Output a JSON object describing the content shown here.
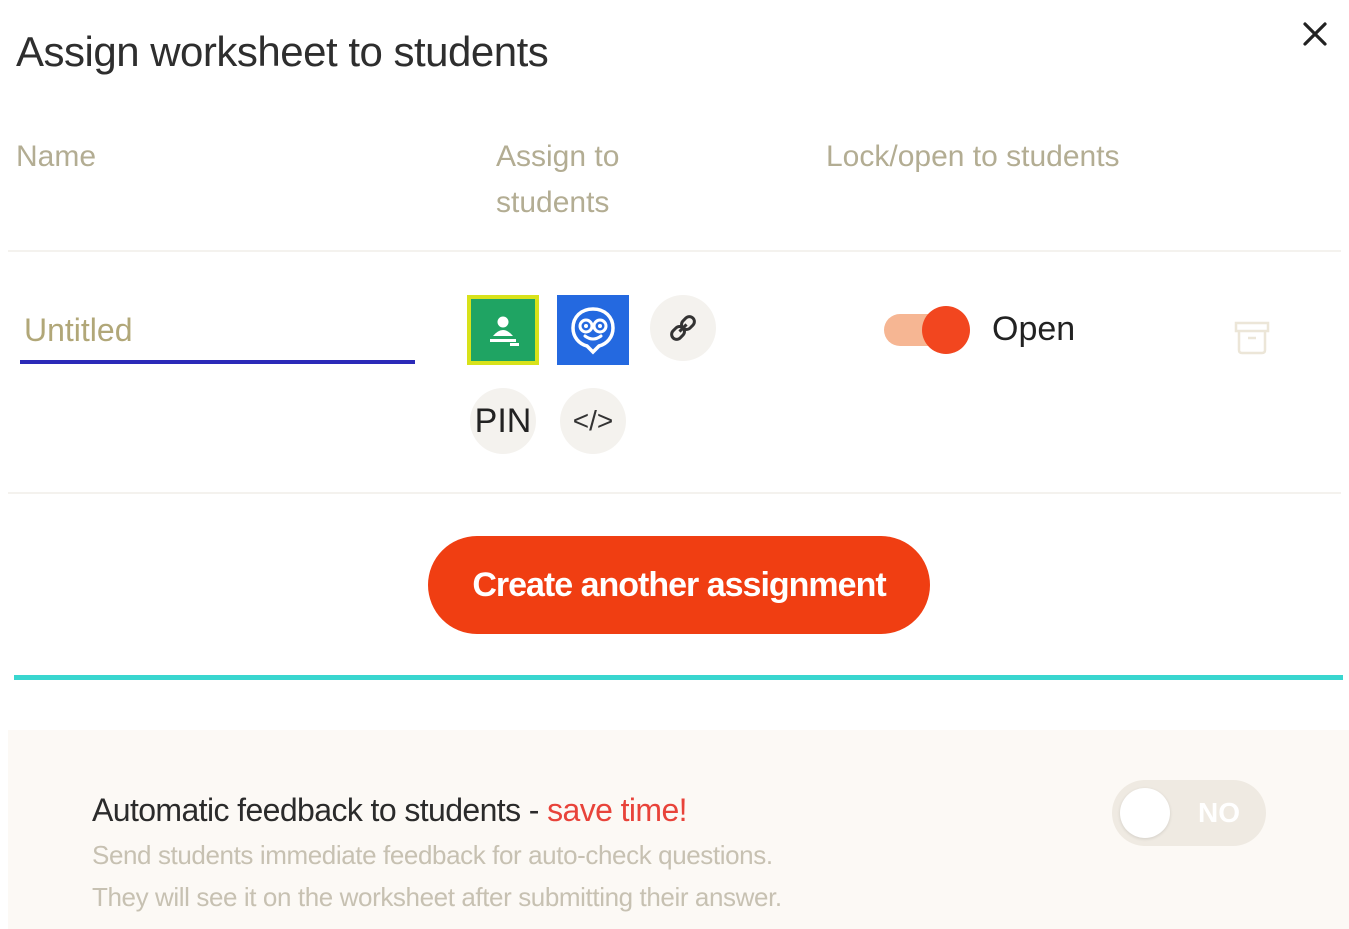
{
  "dialog": {
    "title": "Assign worksheet to students",
    "close_icon": "close-icon"
  },
  "columns": {
    "name": "Name",
    "assign_line1": "Assign to",
    "assign_line2": "students",
    "lock": "Lock/open to students"
  },
  "assignment": {
    "name_placeholder": "Untitled",
    "name_value": "",
    "share_options": [
      {
        "icon": "google-classroom-icon",
        "color": "#1fa463"
      },
      {
        "icon": "edmodo-icon",
        "color": "#2469e0"
      },
      {
        "icon": "link-icon"
      },
      {
        "label": "PIN"
      },
      {
        "label": "</>"
      }
    ],
    "lock_state": "Open",
    "lock_on": true,
    "archive_icon": "archive-icon"
  },
  "create_button": "Create another assignment",
  "feedback": {
    "title": "Automatic feedback to students",
    "separator": " - ",
    "highlight": "save time!",
    "desc_line1": "Send students immediate feedback for auto-check questions.",
    "desc_line2": "They will see it on the worksheet after submitting their answer.",
    "toggle_label": "NO",
    "toggle_on": false
  },
  "colors": {
    "accent": "#f03e12",
    "teal": "#39d6cf",
    "underline": "#2b2ab8",
    "highlight": "#e8433a"
  }
}
